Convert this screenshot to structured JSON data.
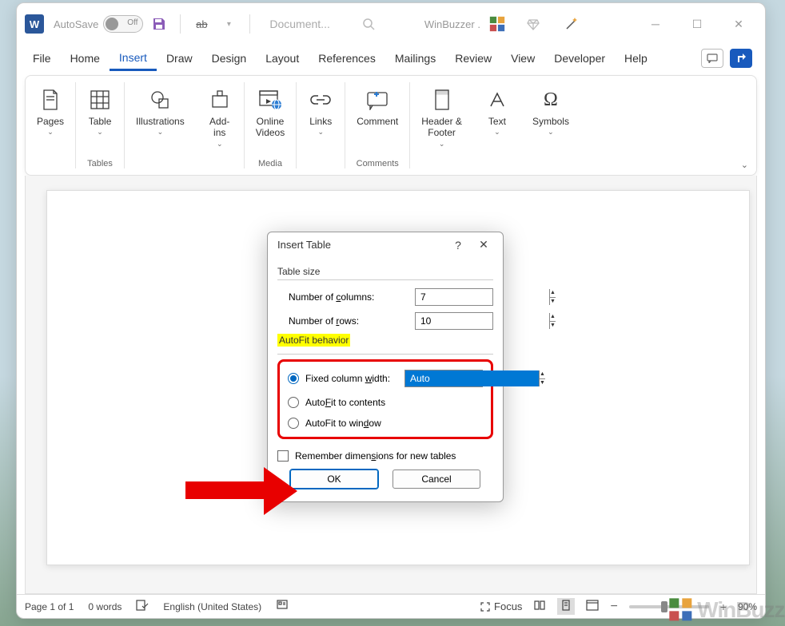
{
  "titlebar": {
    "autosave_label": "AutoSave",
    "autosave_state": "Off",
    "doc_title": "Document...",
    "account": "WinBuzzer ."
  },
  "tabs": {
    "items": [
      "File",
      "Home",
      "Insert",
      "Draw",
      "Design",
      "Layout",
      "References",
      "Mailings",
      "Review",
      "View",
      "Developer",
      "Help"
    ],
    "active": "Insert"
  },
  "ribbon": {
    "groups": [
      {
        "label": "",
        "buttons": [
          {
            "label": "Pages",
            "chevron": true
          }
        ]
      },
      {
        "label": "Tables",
        "buttons": [
          {
            "label": "Table",
            "chevron": true
          }
        ]
      },
      {
        "label": "",
        "buttons": [
          {
            "label": "Illustrations",
            "chevron": true
          },
          {
            "label": "Add-\nins",
            "chevron": true
          }
        ]
      },
      {
        "label": "Media",
        "buttons": [
          {
            "label": "Online\nVideos",
            "chevron": false
          }
        ]
      },
      {
        "label": "",
        "buttons": [
          {
            "label": "Links",
            "chevron": true
          }
        ]
      },
      {
        "label": "Comments",
        "buttons": [
          {
            "label": "Comment",
            "chevron": false
          }
        ]
      },
      {
        "label": "",
        "buttons": [
          {
            "label": "Header &\nFooter",
            "chevron": true
          },
          {
            "label": "Text",
            "chevron": true
          },
          {
            "label": "Symbols",
            "chevron": true
          }
        ]
      }
    ]
  },
  "dialog": {
    "title": "Insert Table",
    "section_table_size": "Table size",
    "col_label": "Number of columns:",
    "col_value": "7",
    "row_label": "Number of rows:",
    "row_value": "10",
    "section_autofit": "AutoFit behavior",
    "opt_fixed": "Fixed column width:",
    "fixed_value": "Auto",
    "opt_contents": "AutoFit to contents",
    "opt_window": "AutoFit to window",
    "remember": "Remember dimensions for new tables",
    "ok": "OK",
    "cancel": "Cancel",
    "selected_radio": "fixed"
  },
  "statusbar": {
    "page": "Page 1 of 1",
    "words": "0 words",
    "lang": "English (United States)",
    "focus": "Focus",
    "zoom": "90%"
  },
  "watermark": "WinBuzzer"
}
